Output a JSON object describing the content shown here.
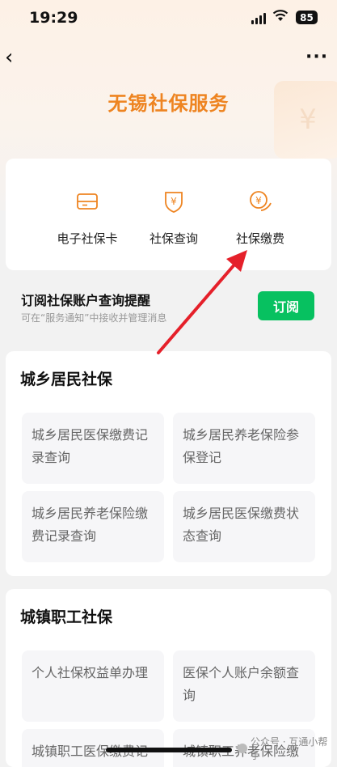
{
  "status_bar": {
    "time": "19:29",
    "battery": "85"
  },
  "nav": {
    "back_glyph": "‹",
    "more_glyph": "···"
  },
  "page_title": "无锡社保服务",
  "quick_actions": [
    {
      "label": "电子社保卡",
      "icon": "card-icon"
    },
    {
      "label": "社保查询",
      "icon": "shield-yen-icon"
    },
    {
      "label": "社保缴费",
      "icon": "yen-pay-icon"
    }
  ],
  "subscribe": {
    "title": "订阅社保账户查询提醒",
    "desc": "可在“服务通知”中接收并管理消息",
    "button": "订阅"
  },
  "sections": [
    {
      "title": "城乡居民社保",
      "items": [
        "城乡居民医保缴费记录查询",
        "城乡居民养老保险参保登记",
        "城乡居民养老保险缴费记录查询",
        "城乡居民医保缴费状态查询"
      ]
    },
    {
      "title": "城镇职工社保",
      "items": [
        "个人社保权益单办理",
        "医保个人账户余额查询",
        "城镇职工医保缴费记",
        "城镇职工养老保险缴"
      ]
    }
  ],
  "watermark": "公众号 · 互通小帮手",
  "colors": {
    "accent": "#ee8421",
    "button_green": "#07c160",
    "arrow_red": "#e5202a"
  }
}
